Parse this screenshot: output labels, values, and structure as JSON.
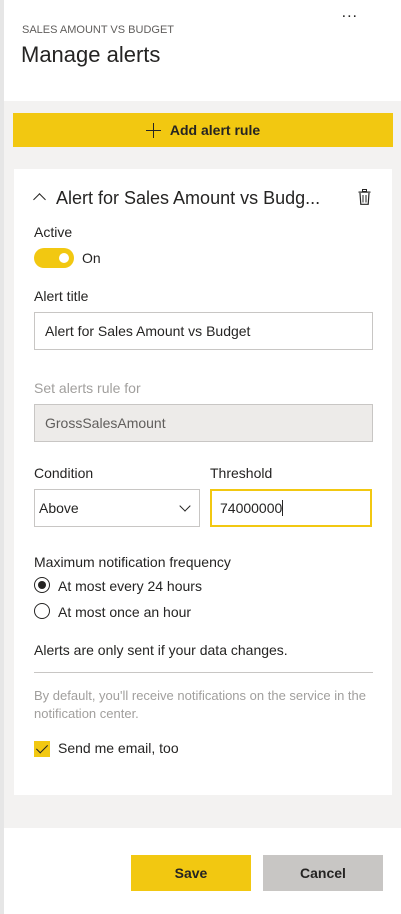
{
  "header": {
    "subtitle": "SALES AMOUNT VS BUDGET",
    "title": "Manage alerts",
    "more_icon": "..."
  },
  "add_rule": {
    "label": "Add alert rule",
    "icon": "plus-icon"
  },
  "alert": {
    "heading": "Alert for Sales Amount vs Budg...",
    "active_label": "Active",
    "active_state": "On",
    "title_label": "Alert title",
    "title_value": "Alert for Sales Amount vs Budget",
    "rule_for_label": "Set alerts rule for",
    "rule_for_value": "GrossSalesAmount",
    "condition_label": "Condition",
    "condition_value": "Above",
    "threshold_label": "Threshold",
    "threshold_value": "74000000",
    "frequency_label": "Maximum notification frequency",
    "frequency_options": [
      "At most every 24 hours",
      "At most once an hour"
    ],
    "frequency_selected": "At most every 24 hours",
    "data_change_note": "Alerts are only sent if your data changes.",
    "default_info": "By default, you'll receive notifications on the service in the notification center.",
    "email_label": "Send me email, too",
    "email_checked": true
  },
  "footer": {
    "save_label": "Save",
    "cancel_label": "Cancel"
  },
  "colors": {
    "accent": "#f2c811",
    "panel_bg": "#f3f2f1",
    "cancel_bg": "#c8c6c4"
  }
}
